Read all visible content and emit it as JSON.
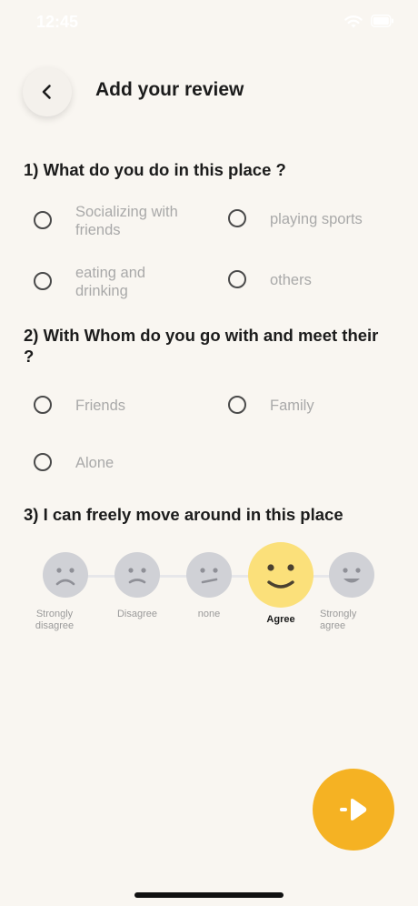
{
  "status_bar": {
    "time": "12:45"
  },
  "header": {
    "title": "Add your review"
  },
  "questions": [
    {
      "text": "1) What do you do in this place ?",
      "options": [
        "Socializing with friends",
        "playing sports",
        "eating and drinking",
        "others"
      ]
    },
    {
      "text": "2) With Whom do you go with and meet their ?",
      "options": [
        "Friends",
        "Family",
        "Alone"
      ]
    },
    {
      "text": "3) I can freely move around in this place",
      "scale": [
        {
          "label": "Strongly disagree",
          "mood": "very-sad"
        },
        {
          "label": "Disagree",
          "mood": "sad"
        },
        {
          "label": "none",
          "mood": "neutral"
        },
        {
          "label": "Agree",
          "mood": "happy"
        },
        {
          "label": "Strongly agree",
          "mood": "very-happy"
        }
      ],
      "selected": "Agree"
    }
  ],
  "colors": {
    "accent": "#f5b223",
    "selected_face": "#fbe07a",
    "inactive_face": "#d0d1d6",
    "background": "#f9f6f1"
  },
  "icons": {
    "back": "chevron-left-icon",
    "next": "arrow-right-icon"
  }
}
